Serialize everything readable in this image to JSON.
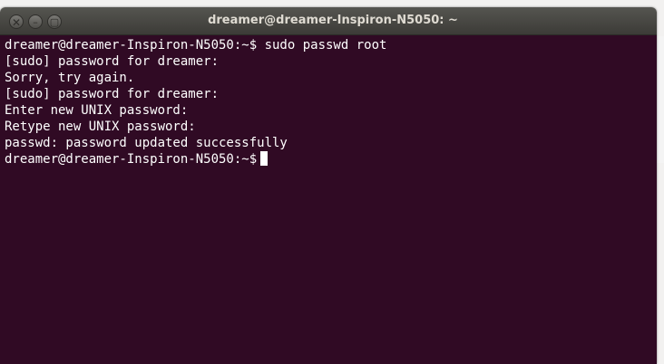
{
  "window": {
    "title": "dreamer@dreamer-Inspiron-N5050: ~"
  },
  "controls": {
    "close_glyph": "✕",
    "minimize_glyph": "–",
    "maximize_glyph": "▢"
  },
  "terminal": {
    "lines": [
      "dreamer@dreamer-Inspiron-N5050:~$ sudo passwd root",
      "[sudo] password for dreamer:",
      "Sorry, try again.",
      "[sudo] password for dreamer:",
      "Enter new UNIX password:",
      "Retype new UNIX password:",
      "passwd: password updated successfully"
    ],
    "prompt": "dreamer@dreamer-Inspiron-N5050:~$"
  },
  "colors": {
    "terminal_bg": "#300a24",
    "terminal_fg": "#ffffff",
    "titlebar": "#3c3b37"
  }
}
